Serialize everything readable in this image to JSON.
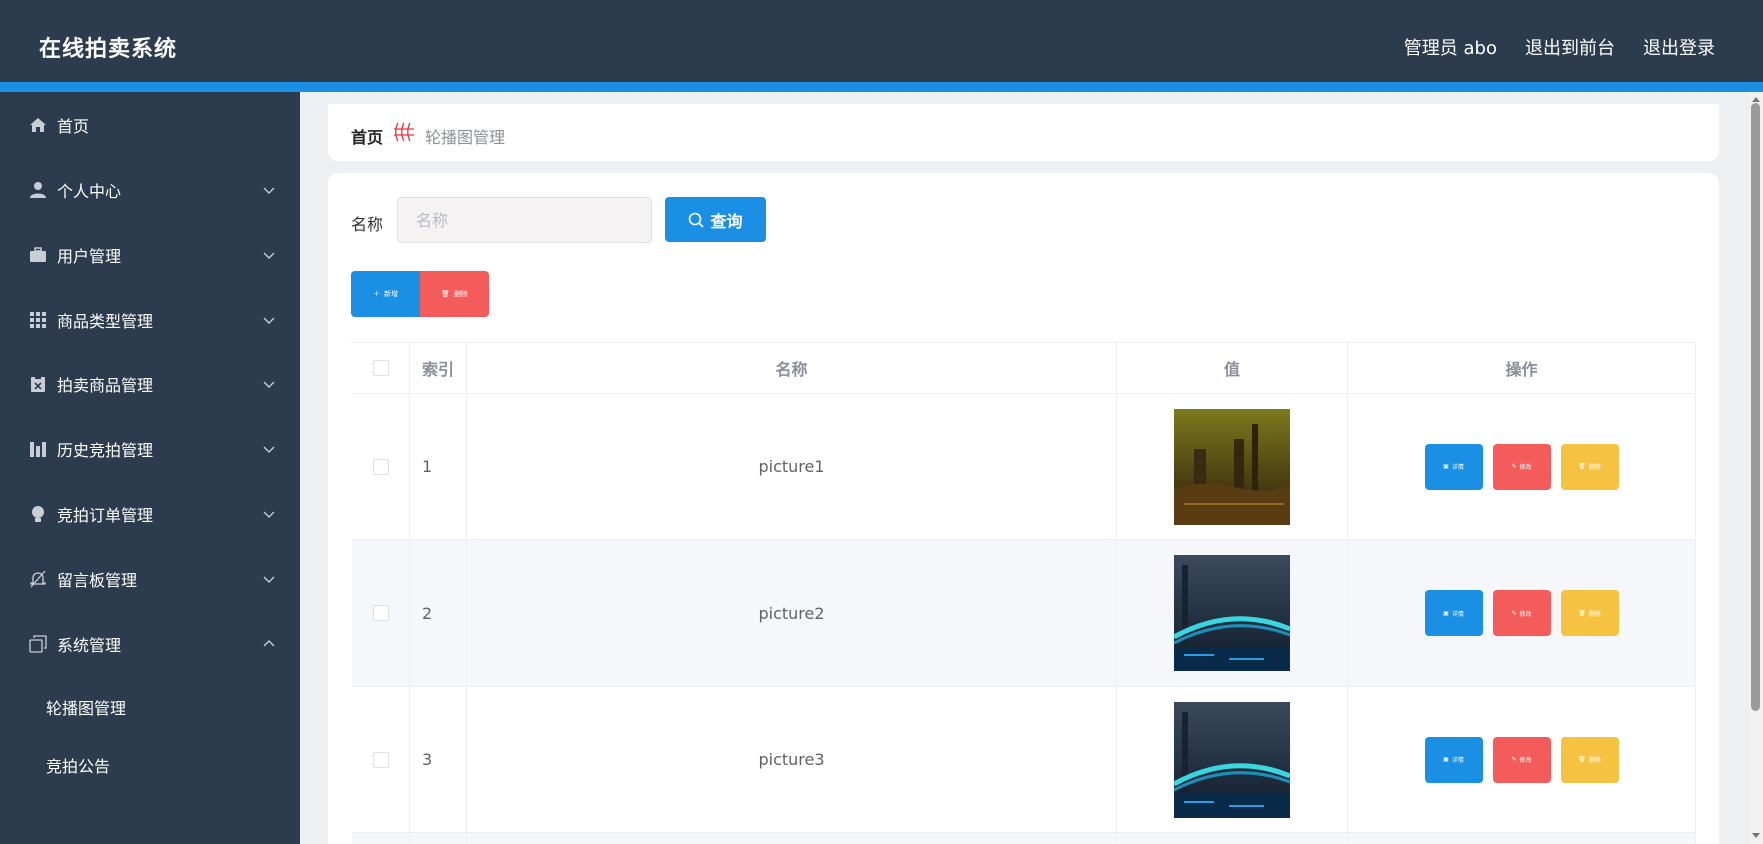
{
  "header": {
    "brand": "在线拍卖系统",
    "links": [
      "管理员 abo",
      "退出到前台",
      "退出登录"
    ]
  },
  "sidebar": {
    "items": [
      {
        "label": "首页",
        "icon": "home-icon"
      },
      {
        "label": "个人中心",
        "icon": "user-icon"
      },
      {
        "label": "用户管理",
        "icon": "briefcase-icon"
      },
      {
        "label": "商品类型管理",
        "icon": "grid-icon"
      },
      {
        "label": "拍卖商品管理",
        "icon": "clipboard-icon"
      },
      {
        "label": "历史竞拍管理",
        "icon": "chart-icon"
      },
      {
        "label": "竞拍订单管理",
        "icon": "bulb-icon"
      },
      {
        "label": "留言板管理",
        "icon": "bell-off-icon"
      },
      {
        "label": "系统管理",
        "icon": "copy-icon"
      }
    ],
    "sub_items": [
      "轮播图管理",
      "竞拍公告"
    ]
  },
  "breadcrumb": {
    "home": "首页",
    "current": "轮播图管理"
  },
  "search": {
    "label": "名称",
    "placeholder": "名称",
    "button": "查询"
  },
  "actions": {
    "add": "新增",
    "delete": "删除"
  },
  "table": {
    "columns": [
      "索引",
      "名称",
      "值",
      "操作"
    ],
    "rows": [
      {
        "index": "1",
        "name": "picture1",
        "thumb": "castle-at-dusk"
      },
      {
        "index": "2",
        "name": "picture2",
        "thumb": "lit-bridge-at-night"
      },
      {
        "index": "3",
        "name": "picture3",
        "thumb": "lit-bridge-at-night"
      }
    ],
    "row_actions": {
      "detail": "详情",
      "edit": "修改",
      "delete": "删除"
    }
  },
  "colors": {
    "header_bg": "#2d3b4e",
    "accent_blue": "#1a8fe3",
    "danger_red": "#f45b5b",
    "warning_yellow": "#f5c242"
  }
}
